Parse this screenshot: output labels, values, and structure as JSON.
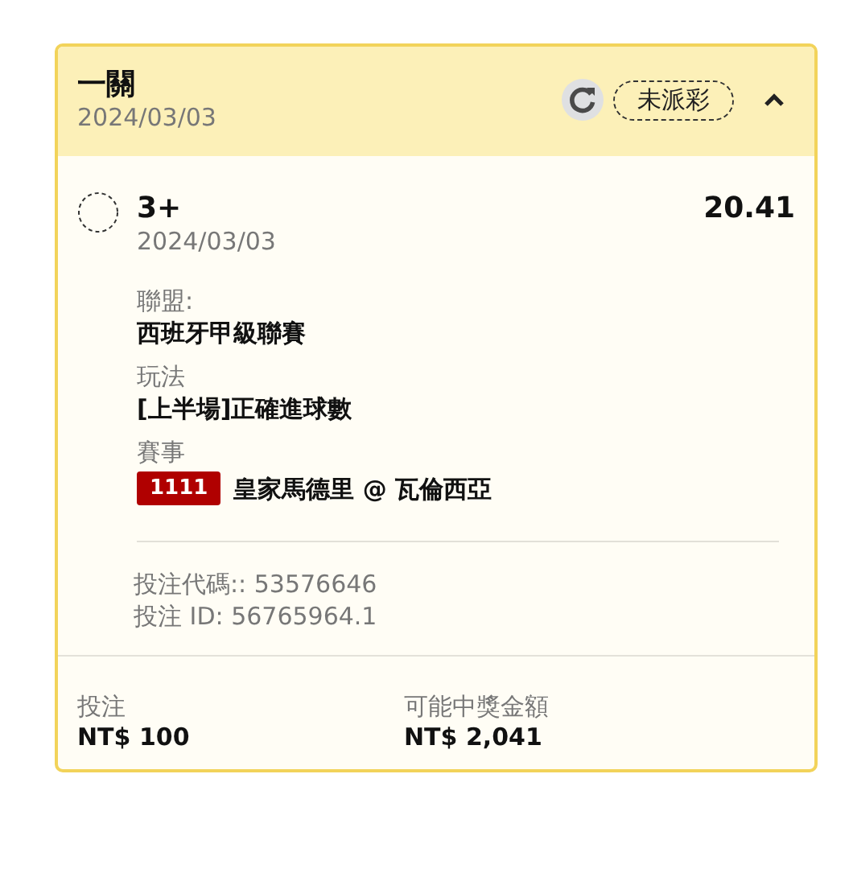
{
  "header": {
    "title": "一關",
    "date": "2024/03/03",
    "status": "未派彩",
    "expanded": true
  },
  "selection": {
    "name": "3+",
    "date": "2024/03/03",
    "odds": "20.41",
    "details": [
      {
        "label": "聯盟:",
        "value": "西班牙甲級聯賽"
      },
      {
        "label": "玩法",
        "value": "[上半場]正確進球數"
      },
      {
        "label": "賽事",
        "code": "1111",
        "value": "皇家馬德里 @ 瓦倫西亞"
      }
    ],
    "codes": [
      "投注代碼:: 53576646",
      "投注 ID: 56765964.1"
    ]
  },
  "footer": [
    {
      "label": "投注",
      "value": "NT$ 100"
    },
    {
      "label": "可能中獎金額",
      "value": "NT$ 2,041"
    }
  ]
}
